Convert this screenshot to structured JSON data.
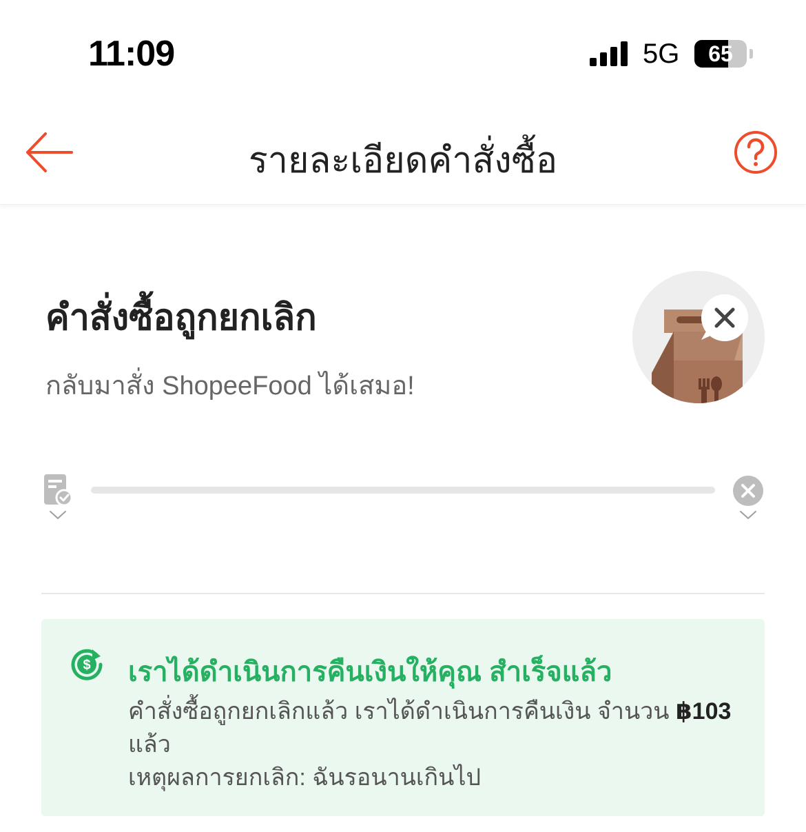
{
  "status_bar": {
    "time": "11:09",
    "network": "5G",
    "battery_percent": "65",
    "battery_level": 0.65
  },
  "header": {
    "title": "รายละเอียดคำสั่งซื้อ",
    "back_icon": "arrow-left-icon",
    "help_icon": "question-circle-icon",
    "accent_color": "#ee4d2d"
  },
  "order_status": {
    "title": "คำสั่งซื้อถูกยกเลิก",
    "subtitle": "กลับมาสั่ง ShopeeFood ได้เสมอ!",
    "illustration": "cancelled-food-bag-icon"
  },
  "progress": {
    "start_icon": "order-receipt-icon",
    "end_icon": "cancelled-x-icon"
  },
  "refund": {
    "title": "เราได้ดำเนินการคืนเงินให้คุณ สำเร็จแล้ว",
    "message_prefix": "คำสั่งซื้อถูกยกเลิกแล้ว เราได้ดำเนินการคืนเงิน จำนวน ",
    "amount": "฿103",
    "message_suffix": " แล้ว",
    "reason": "เหตุผลการยกเลิก: ฉันรอนานเกินไป",
    "icon": "refund-dollar-icon",
    "color": "#26b062"
  }
}
